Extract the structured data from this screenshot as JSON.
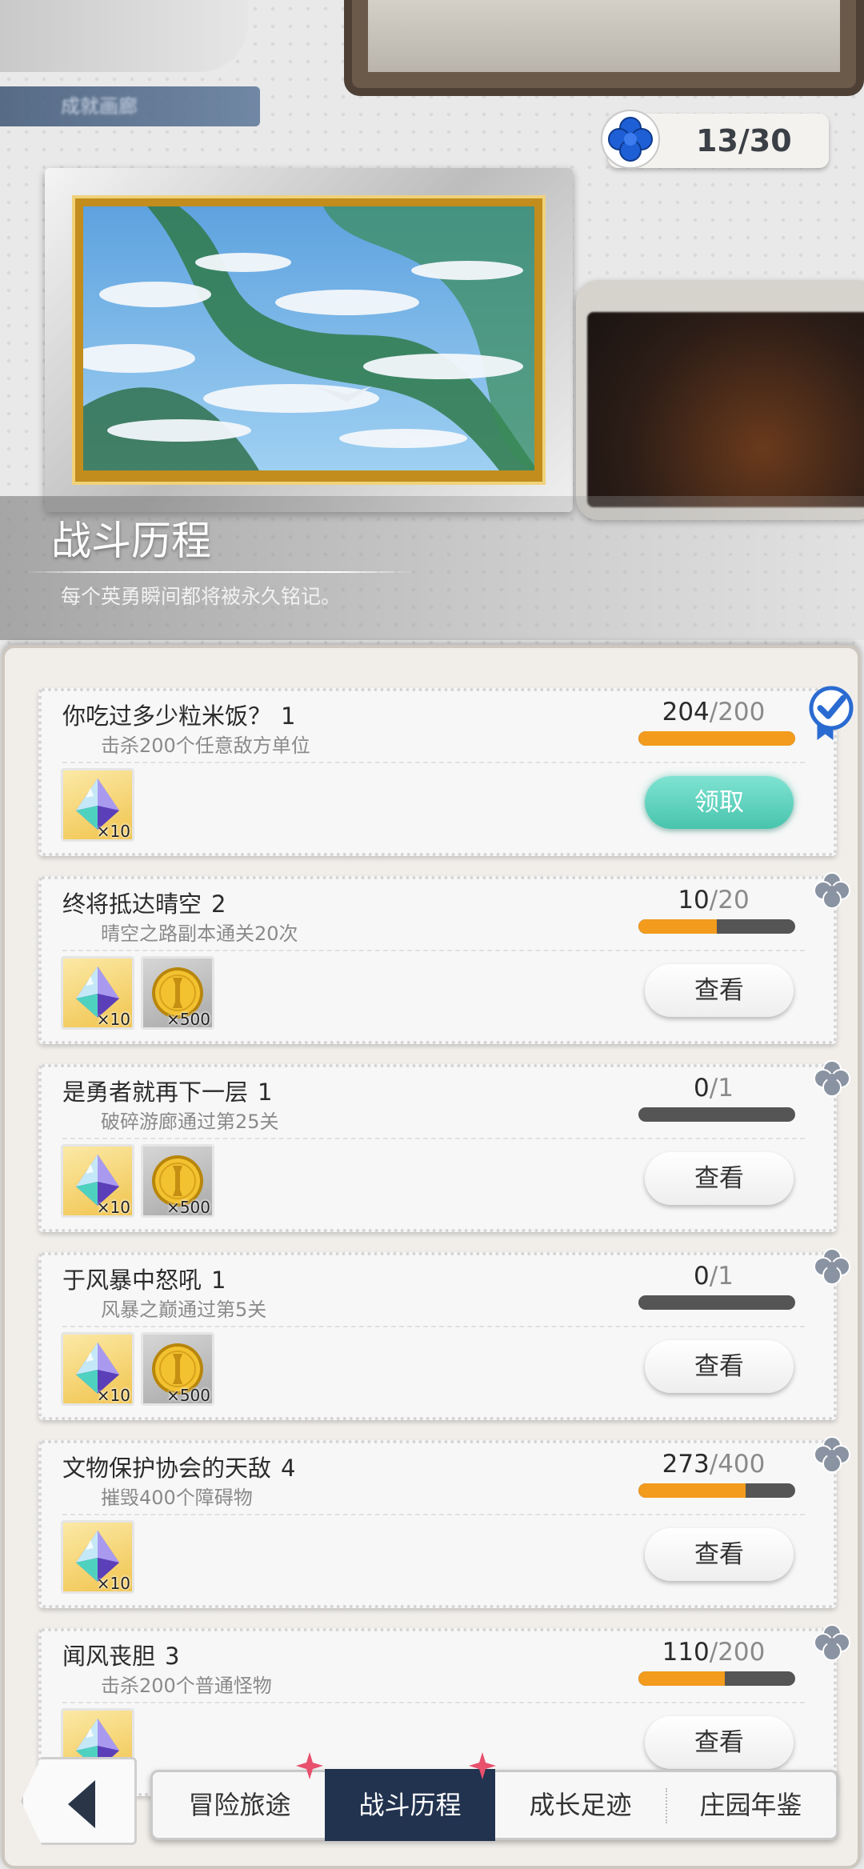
{
  "counter": {
    "value": "13/30"
  },
  "banner": {
    "tag": "成就画廊"
  },
  "section": {
    "title": "战斗历程",
    "subtitle": "每个英勇瞬间都将被永久铭记。"
  },
  "colors": {
    "accent_orange": "#f29b1d",
    "claim_teal": "#48c4ad",
    "tab_active": "#22334f"
  },
  "achievements": [
    {
      "title": "你吃过多少粒米饭？",
      "stage": "1",
      "desc": "击杀200个任意敌方单位",
      "progress_current": "204",
      "progress_total": "/200",
      "progress_ratio": 1.0,
      "rewards": [
        {
          "icon": "crystal-icon",
          "qty": "×10"
        }
      ],
      "button": "领取",
      "completed": true
    },
    {
      "title": "终将抵达晴空",
      "stage": "2",
      "desc": "晴空之路副本通关20次",
      "progress_current": "10",
      "progress_total": "/20",
      "progress_ratio": 0.5,
      "rewards": [
        {
          "icon": "crystal-icon",
          "qty": "×10"
        },
        {
          "icon": "gold-coin-icon",
          "qty": "×500"
        }
      ],
      "button": "查看",
      "completed": false
    },
    {
      "title": "是勇者就再下一层",
      "stage": "1",
      "desc": "破碎游廊通过第25关",
      "progress_current": "0",
      "progress_total": "/1",
      "progress_ratio": 0.0,
      "rewards": [
        {
          "icon": "crystal-icon",
          "qty": "×10"
        },
        {
          "icon": "gold-coin-icon",
          "qty": "×500"
        }
      ],
      "button": "查看",
      "completed": false
    },
    {
      "title": "于风暴中怒吼",
      "stage": "1",
      "desc": "风暴之巅通过第5关",
      "progress_current": "0",
      "progress_total": "/1",
      "progress_ratio": 0.0,
      "rewards": [
        {
          "icon": "crystal-icon",
          "qty": "×10"
        },
        {
          "icon": "gold-coin-icon",
          "qty": "×500"
        }
      ],
      "button": "查看",
      "completed": false
    },
    {
      "title": "文物保护协会的天敌",
      "stage": "4",
      "desc": "摧毁400个障碍物",
      "progress_current": "273",
      "progress_total": "/400",
      "progress_ratio": 0.6825,
      "rewards": [
        {
          "icon": "crystal-icon",
          "qty": "×10"
        }
      ],
      "button": "查看",
      "completed": false
    },
    {
      "title": "闻风丧胆",
      "stage": "3",
      "desc": "击杀200个普通怪物",
      "progress_current": "110",
      "progress_total": "/200",
      "progress_ratio": 0.55,
      "rewards": [
        {
          "icon": "crystal-icon",
          "qty": ""
        }
      ],
      "button": "查看",
      "completed": false
    }
  ],
  "tabs": [
    {
      "label": "冒险旅途",
      "active": false
    },
    {
      "label": "战斗历程",
      "active": true
    },
    {
      "label": "成长足迹",
      "active": false
    },
    {
      "label": "庄园年鉴",
      "active": false
    }
  ]
}
